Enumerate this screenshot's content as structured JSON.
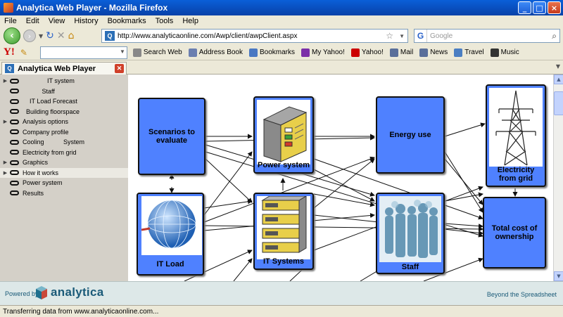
{
  "window": {
    "title": "Analytica Web Player - Mozilla Firefox"
  },
  "menu": [
    "File",
    "Edit",
    "View",
    "History",
    "Bookmarks",
    "Tools",
    "Help"
  ],
  "nav": {
    "url": "http://www.analyticaonline.com/Awp/client/awpClient.aspx",
    "search_placeholder": "Google"
  },
  "yahoo_toolbar": {
    "items": [
      {
        "label": "Search Web",
        "icon": "search-web-icon",
        "color": "#888888"
      },
      {
        "label": "Address Book",
        "icon": "address-book-icon",
        "color": "#6b7fb0"
      },
      {
        "label": "Bookmarks",
        "icon": "bookmarks-icon",
        "color": "#4a78c2"
      },
      {
        "label": "My Yahoo!",
        "icon": "my-yahoo-icon",
        "color": "#7b2fa8"
      },
      {
        "label": "Yahoo!",
        "icon": "yahoo-icon",
        "color": "#cc0000"
      },
      {
        "label": "Mail",
        "icon": "mail-icon",
        "color": "#5a6f9a"
      },
      {
        "label": "News",
        "icon": "news-icon",
        "color": "#5a6f9a"
      },
      {
        "label": "Travel",
        "icon": "travel-icon",
        "color": "#4a7ec2"
      },
      {
        "label": "Music",
        "icon": "music-icon",
        "color": "#333333"
      }
    ]
  },
  "tab": {
    "label": "Analytica Web Player"
  },
  "tree": [
    {
      "label": "              IT system",
      "arrow": "▶",
      "selected": false
    },
    {
      "label": "           Staff",
      "arrow": "",
      "selected": false
    },
    {
      "label": "    IT Load Forecast",
      "arrow": "",
      "selected": false
    },
    {
      "label": "  Building floorspace",
      "arrow": "",
      "selected": false
    },
    {
      "label": "Analysis options",
      "arrow": "▶",
      "selected": false
    },
    {
      "label": "Company profile",
      "arrow": "",
      "selected": false
    },
    {
      "label": "Cooling           System",
      "arrow": "",
      "selected": false
    },
    {
      "label": "Electricity from grid",
      "arrow": "",
      "selected": false
    },
    {
      "label": "Graphics",
      "arrow": "▶",
      "selected": false
    },
    {
      "label": "How it works",
      "arrow": "▶",
      "selected": true
    },
    {
      "label": "Power system",
      "arrow": "",
      "selected": false
    },
    {
      "label": "Results",
      "arrow": "",
      "selected": false
    }
  ],
  "diagram": {
    "nodes": {
      "scenarios": "Scenarios to evaluate",
      "power_system": "Power system",
      "energy_use": "Energy use",
      "electricity_grid": "Electricity from grid",
      "it_load": "IT Load",
      "it_systems": "IT Systems",
      "staff": "Staff",
      "total_cost": "Total cost of ownership"
    },
    "node_color": "#4f81ff"
  },
  "footer": {
    "powered_by": "Powered by",
    "brand": "analytica",
    "tagline": "Beyond the Spreadsheet"
  },
  "status": "Transferring data from www.analyticaonline.com..."
}
